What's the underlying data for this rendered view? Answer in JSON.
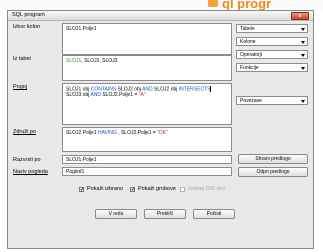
{
  "background_brand": {
    "text": "ql progr"
  },
  "window": {
    "title": "SQL program",
    "close_label": "x"
  },
  "labels": {
    "izbor_kolon": "Izbor kolon",
    "iz_tabel": "Iz tabel",
    "pogoj": "Pogoj",
    "zdruzi_po": "Združi po",
    "razvrsti_po": "Razvrsti po",
    "naziv_pogleda": "Naziv pogleda"
  },
  "fields": {
    "izbor_kolon": "SLOJ1.Polje1",
    "iz_tabel": {
      "t1": "SLOJ1",
      "rest": ", SLOJ2, SLOJ3"
    },
    "pogoj": {
      "line1": [
        {
          "t": "SLOJ1 obj ",
          "c": ""
        },
        {
          "t": "CONTAINS",
          "c": "blue"
        },
        {
          "t": " SLOJ2 obj ",
          "c": ""
        },
        {
          "t": "AND",
          "c": "blue"
        },
        {
          "t": " SLOJ2 obj ",
          "c": ""
        },
        {
          "t": "INTERSECTS",
          "c": "blue"
        }
      ],
      "line2": [
        {
          "t": "SLOJ3 obj ",
          "c": ""
        },
        {
          "t": "AND",
          "c": "blue"
        },
        {
          "t": " SLOJ2.Polje1 = ",
          "c": ""
        },
        {
          "t": "\"A\"",
          "c": "red"
        }
      ]
    },
    "zdruzi_po": [
      {
        "t": "SLOJ2.Polje1 ",
        "c": ""
      },
      {
        "t": "HAVING",
        "c": "blue"
      },
      {
        "t": " , SLOJ2.Polje1 = ",
        "c": ""
      },
      {
        "t": "\"DK\"",
        "c": "red"
      }
    ],
    "razvrsti_po": "SLOJ1.Polje1",
    "naziv_pogleda": "Pogled1"
  },
  "combos": {
    "tabele": "Tabele",
    "kolone": "Kolone",
    "operatorji": "Operatorji",
    "funkcije": "Funkcije",
    "povezave": "Povezave"
  },
  "buttons": {
    "shrani": "Shrani predlogo",
    "odpri": "Odpri predlogo",
    "v_redu": "V redu",
    "preklici": "Prekliči",
    "pocisti": "Počisti"
  },
  "checkboxes": {
    "pokazi_izbrano": {
      "label": "Pokaži izbrano",
      "checked": true
    },
    "pokazi_grobove": {
      "label": "Pokaži grobove",
      "checked": true
    },
    "izdelaj": {
      "label": "Izdelaj GIS sloj",
      "checked": false
    }
  }
}
